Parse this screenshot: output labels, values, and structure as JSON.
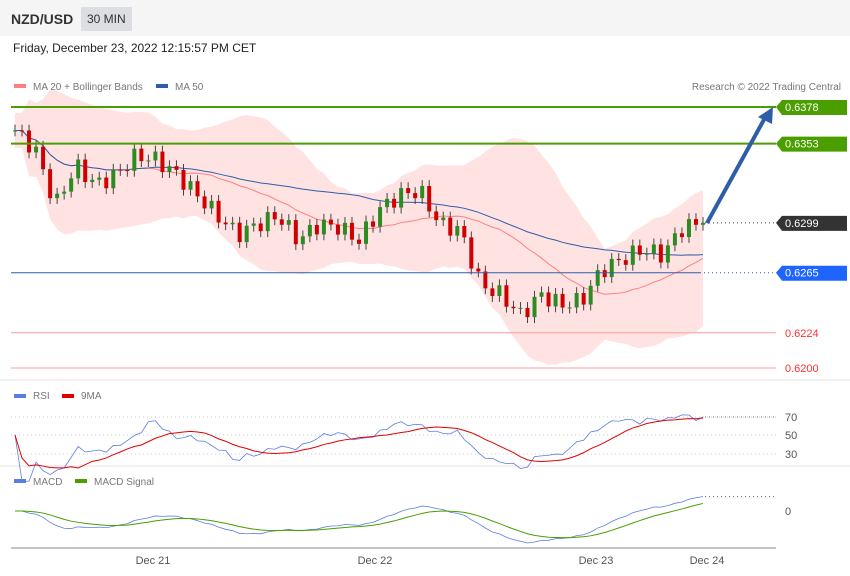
{
  "header": {
    "symbol": "NZD/USD",
    "timeframe": "30 MIN",
    "datetime": "Friday, December 23, 2022 12:15:57 PM CET"
  },
  "copyright": "Research © 2022 Trading Central",
  "chart_data": {
    "type": "candlestick",
    "legend": [
      {
        "label": "MA 20 + Bollinger Bands",
        "color": "#ff7f7f"
      },
      {
        "label": "MA 50",
        "color": "#2e5ea8"
      }
    ],
    "closes": [
      0.6362,
      0.6349,
      0.6311,
      0.6338,
      0.6325,
      0.6332,
      0.6345,
      0.6342,
      0.6332,
      0.6318,
      0.6304,
      0.6291,
      0.6298,
      0.6304,
      0.6287,
      0.6298,
      0.6296,
      0.6287,
      0.6308,
      0.6318,
      0.6321,
      0.6298,
      0.6294,
      0.6257,
      0.625,
      0.6236,
      0.625,
      0.6243,
      0.6246,
      0.6267,
      0.6274,
      0.6281,
      0.6277,
      0.6296,
      0.6299
    ],
    "ylim": [
      0.619,
      0.639
    ],
    "levels": [
      {
        "value": "0.6378",
        "color": "#4a9e00",
        "type": "resistance"
      },
      {
        "value": "0.6353",
        "color": "#4a9e00",
        "type": "resistance"
      },
      {
        "value": "0.6299",
        "color": "#333333",
        "type": "last"
      },
      {
        "value": "0.6265",
        "color": "#1e64ff",
        "type": "pivot"
      },
      {
        "value": "0.6224",
        "color": "#ff3030",
        "type": "support"
      },
      {
        "value": "0.6200",
        "color": "#ff3030",
        "type": "support"
      }
    ],
    "xticks": [
      "Dec 21",
      "Dec 22",
      "Dec 23",
      "Dec 24"
    ],
    "rsi": {
      "legend": [
        "RSI",
        "9MA"
      ],
      "colors": [
        "#5a7de0",
        "#e00000"
      ],
      "ticks": [
        "70",
        "50",
        "30"
      ]
    },
    "macd": {
      "legend": [
        "MACD",
        "MACD Signal"
      ],
      "colors": [
        "#5a7de0",
        "#4a9e00"
      ],
      "ticks": [
        "0"
      ]
    }
  }
}
